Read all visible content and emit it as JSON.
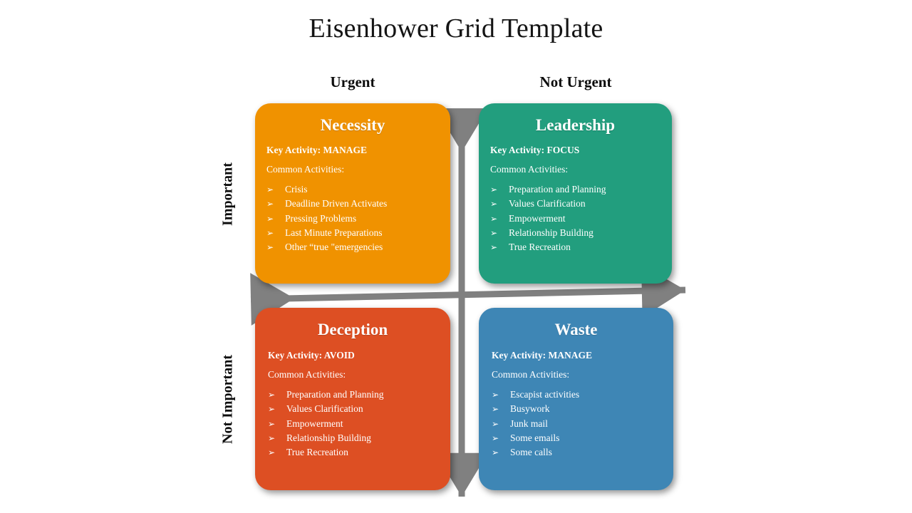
{
  "page": {
    "title": "Eisenhower Grid Template",
    "background_color": "#ffffff"
  },
  "axes": {
    "color": "#808080",
    "column_labels": {
      "left": "Urgent",
      "right": "Not Urgent"
    },
    "row_labels": {
      "top": "Important",
      "bottom": "Not Important"
    }
  },
  "common": {
    "key_activity_prefix": "Key Activity:",
    "common_activities_label": "Common Activities:",
    "bullet_glyph": "➢"
  },
  "quadrants": [
    {
      "id": "necessity",
      "title": "Necessity",
      "key_activity": "Key Activity: MANAGE",
      "common_label": "Common Activities:",
      "color": "#F09200",
      "position": "urgent-important",
      "activities": [
        "Crisis",
        "Deadline Driven Activates",
        "Pressing Problems",
        "Last Minute Preparations",
        "Other “true \"emergencies"
      ]
    },
    {
      "id": "leadership",
      "title": "Leadership",
      "key_activity": "Key Activity: FOCUS",
      "common_label": "Common Activities:",
      "color": "#229E7E",
      "position": "not-urgent-important",
      "activities": [
        "Preparation and Planning",
        "Values Clarification",
        "Empowerment",
        "Relationship Building",
        "True Recreation"
      ]
    },
    {
      "id": "deception",
      "title": "Deception",
      "key_activity": "Key Activity: AVOID",
      "common_label": "Common Activities:",
      "color": "#DD4F23",
      "position": "urgent-not-important",
      "activities": [
        "Preparation and Planning",
        "Values Clarification",
        "Empowerment",
        "Relationship Building",
        "True Recreation"
      ]
    },
    {
      "id": "waste",
      "title": "Waste",
      "key_activity": "Key Activity: MANAGE",
      "common_label": "Common Activities:",
      "color": "#3E86B5",
      "position": "not-urgent-not-important",
      "activities": [
        "Escapist activities",
        "Busywork",
        "Junk mail",
        "Some emails",
        "Some calls"
      ]
    }
  ]
}
